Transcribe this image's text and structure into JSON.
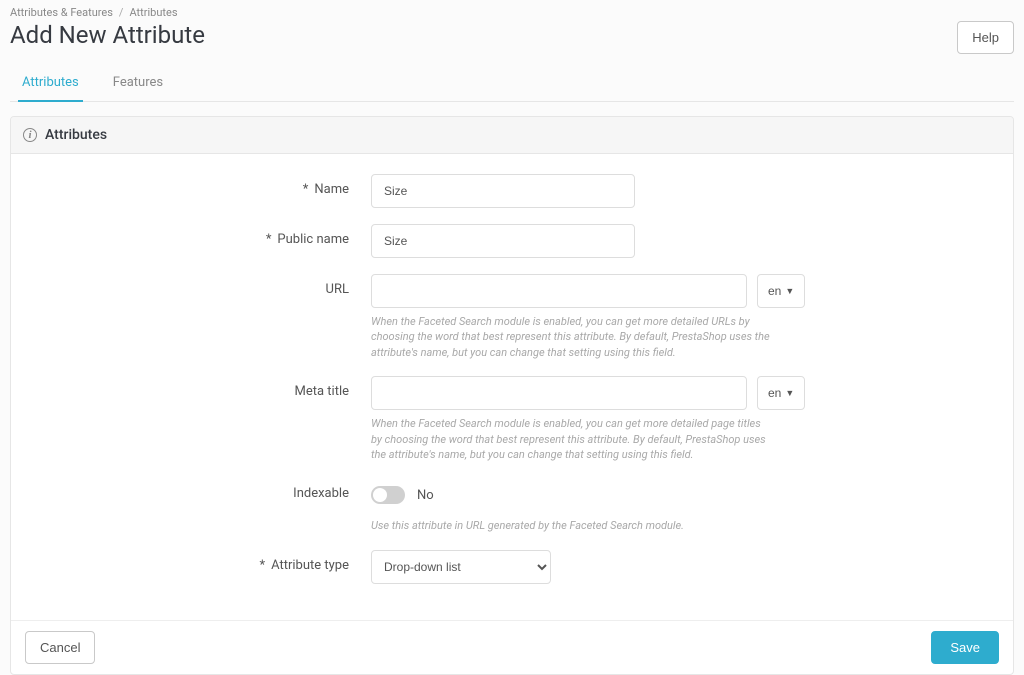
{
  "breadcrumb": {
    "parent": "Attributes & Features",
    "current": "Attributes"
  },
  "page_title": "Add New Attribute",
  "help_label": "Help",
  "tabs": {
    "attributes": "Attributes",
    "features": "Features"
  },
  "panel_title": "Attributes",
  "form": {
    "name": {
      "label": "Name",
      "value": "Size"
    },
    "public_name": {
      "label": "Public name",
      "value": "Size"
    },
    "url": {
      "label": "URL",
      "value": "",
      "lang": "en",
      "help": "When the Faceted Search module is enabled, you can get more detailed URLs by choosing the word that best represent this attribute. By default, PrestaShop uses the attribute's name, but you can change that setting using this field."
    },
    "meta_title": {
      "label": "Meta title",
      "value": "",
      "lang": "en",
      "help": "When the Faceted Search module is enabled, you can get more detailed page titles by choosing the word that best represent this attribute. By default, PrestaShop uses the attribute's name, but you can change that setting using this field."
    },
    "indexable": {
      "label": "Indexable",
      "state_label": "No",
      "help": "Use this attribute in URL generated by the Faceted Search module."
    },
    "attribute_type": {
      "label": "Attribute type",
      "selected": "Drop-down list"
    }
  },
  "footer": {
    "cancel": "Cancel",
    "save": "Save"
  }
}
